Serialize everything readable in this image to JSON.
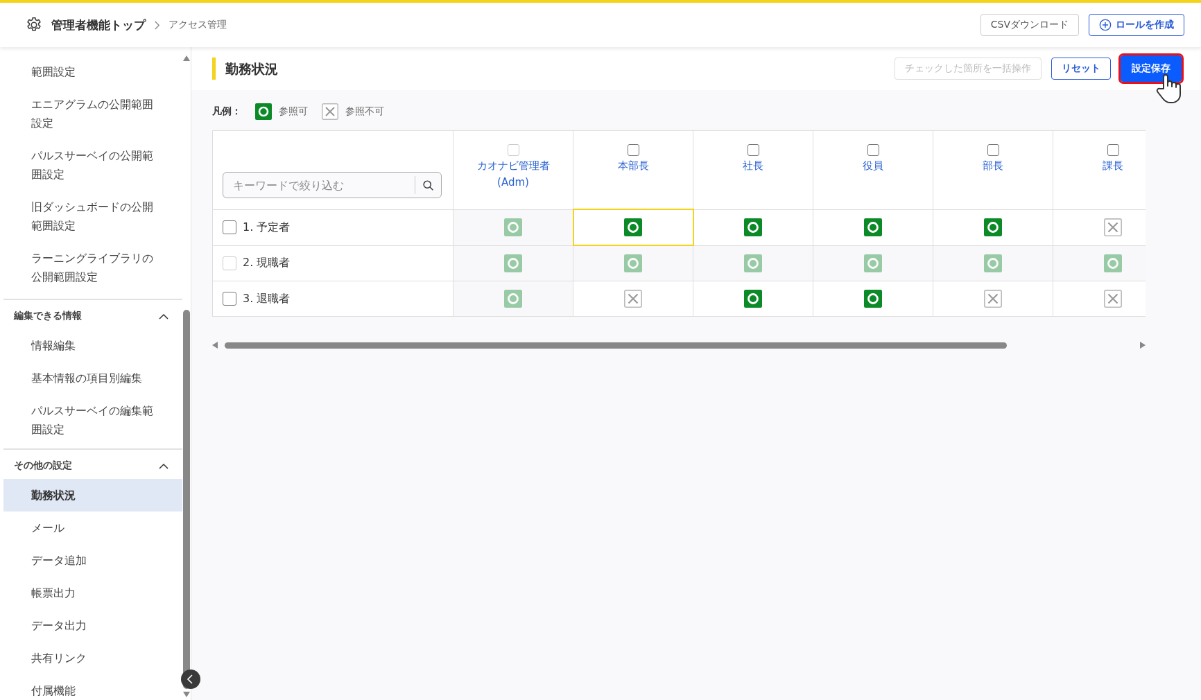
{
  "header": {
    "title": "管理者機能トップ",
    "breadcrumb": "アクセス管理",
    "buttons": [
      {
        "label": "CSVダウンロード",
        "kind": "plain"
      },
      {
        "label": "ロールを作成",
        "kind": "create"
      }
    ]
  },
  "sidebar": {
    "items": [
      {
        "label": "範囲設定",
        "selected": false
      },
      {
        "label": "エニアグラムの公開範囲設定",
        "selected": false
      },
      {
        "label": "パルスサーベイの公開範囲設定",
        "selected": false
      },
      {
        "label": "旧ダッシュボードの公開範囲設定",
        "selected": false
      },
      {
        "label": "ラーニングライブラリの公開範囲設定",
        "selected": false
      }
    ],
    "sections": [
      {
        "title": "編集できる情報",
        "expanded": true,
        "items": [
          {
            "label": "情報編集",
            "selected": false
          },
          {
            "label": "基本情報の項目別編集",
            "selected": false
          },
          {
            "label": "パルスサーベイの編集範囲設定",
            "selected": false
          }
        ]
      },
      {
        "title": "その他の設定",
        "expanded": true,
        "items": [
          {
            "label": "勤務状況",
            "selected": true
          },
          {
            "label": "メール",
            "selected": false
          },
          {
            "label": "データ追加",
            "selected": false
          },
          {
            "label": "帳票出力",
            "selected": false
          },
          {
            "label": "データ出力",
            "selected": false
          },
          {
            "label": "共有リンク",
            "selected": false
          },
          {
            "label": "付属機能",
            "selected": false
          }
        ]
      }
    ]
  },
  "page": {
    "title": "勤務状況",
    "actions": [
      {
        "label": "チェックした箇所を一括操作",
        "kind": "disabled"
      },
      {
        "label": "リセット",
        "kind": "outline"
      },
      {
        "label": "設定保存",
        "kind": "primary"
      }
    ]
  },
  "legend": {
    "label": "凡例：",
    "items": [
      {
        "kind": "allow",
        "label": "参照可"
      },
      {
        "kind": "deny",
        "label": "参照不可"
      }
    ]
  },
  "table": {
    "search": {
      "placeholder": "キーワードで絞り込む"
    },
    "columns": [
      {
        "label": "カオナビ管理者",
        "sublabel": "(Adm)",
        "checked": false,
        "disabled": true
      },
      {
        "label": "本部長",
        "checked": false,
        "disabled": false
      },
      {
        "label": "社長",
        "checked": false,
        "disabled": false
      },
      {
        "label": "役員",
        "checked": false,
        "disabled": false
      },
      {
        "label": "部長",
        "checked": false,
        "disabled": false
      },
      {
        "label": "課長",
        "checked": false,
        "disabled": false
      }
    ],
    "rows": [
      {
        "label": "1. 予定者",
        "checked": false,
        "disabled": false,
        "cells": [
          {
            "kind": "allow",
            "disabled": true,
            "focused": false
          },
          {
            "kind": "allow",
            "disabled": false,
            "focused": true
          },
          {
            "kind": "allow",
            "disabled": false,
            "focused": false
          },
          {
            "kind": "allow",
            "disabled": false,
            "focused": false
          },
          {
            "kind": "allow",
            "disabled": false,
            "focused": false
          },
          {
            "kind": "deny",
            "disabled": false,
            "focused": false
          }
        ]
      },
      {
        "label": "2. 現職者",
        "checked": false,
        "disabled": true,
        "cells": [
          {
            "kind": "allow",
            "disabled": true,
            "focused": false
          },
          {
            "kind": "allow",
            "disabled": true,
            "focused": false
          },
          {
            "kind": "allow",
            "disabled": true,
            "focused": false
          },
          {
            "kind": "allow",
            "disabled": true,
            "focused": false
          },
          {
            "kind": "allow",
            "disabled": true,
            "focused": false
          },
          {
            "kind": "allow",
            "disabled": true,
            "focused": false
          }
        ]
      },
      {
        "label": "3. 退職者",
        "checked": false,
        "disabled": false,
        "cells": [
          {
            "kind": "allow",
            "disabled": true,
            "focused": false
          },
          {
            "kind": "deny",
            "disabled": false,
            "focused": false
          },
          {
            "kind": "allow",
            "disabled": false,
            "focused": false
          },
          {
            "kind": "allow",
            "disabled": false,
            "focused": false
          },
          {
            "kind": "deny",
            "disabled": false,
            "focused": false
          },
          {
            "kind": "deny",
            "disabled": false,
            "focused": false
          }
        ]
      }
    ]
  }
}
